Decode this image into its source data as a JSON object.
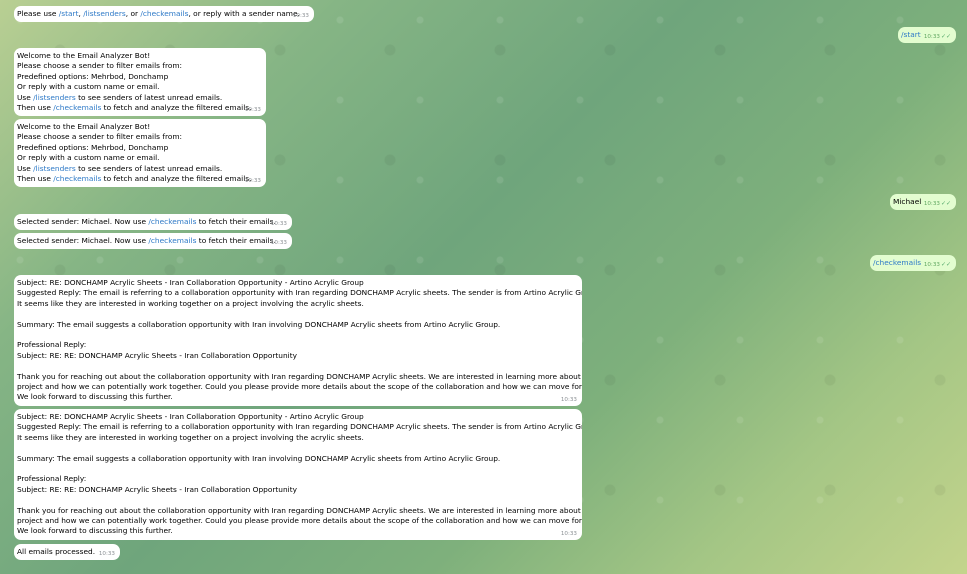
{
  "messages": {
    "m1": {
      "pre": "Please use ",
      "c1": "/start",
      "sep1": ", ",
      "c2": "/listsenders",
      "sep2": ", or ",
      "c3": "/checkemails",
      "post": ", or reply with a sender name.",
      "time": "10:33"
    },
    "start_cmd": {
      "text": "/start",
      "time": "10:33"
    },
    "welcome1": {
      "l1": "Welcome to the Email Analyzer Bot!",
      "l2": "Please choose a sender to filter emails from:",
      "l3": "Predefined options: Mehrbod, Donchamp",
      "l4": "Or reply with a custom name or email.",
      "l5_pre": "Use ",
      "l5_cmd": "/listsenders",
      "l5_post": " to see senders of latest unread emails.",
      "l6_pre": "Then use ",
      "l6_cmd": "/checkemails",
      "l6_post": " to fetch and analyze the filtered emails.",
      "time": "10:33"
    },
    "welcome2": {
      "l1": "Welcome to the Email Analyzer Bot!",
      "l2": "Please choose a sender to filter emails from:",
      "l3": "Predefined options: Mehrbod, Donchamp",
      "l4": "Or reply with a custom name or email.",
      "l5_pre": "Use ",
      "l5_cmd": "/listsenders",
      "l5_post": " to see senders of latest unread emails.",
      "l6_pre": "Then use ",
      "l6_cmd": "/checkemails",
      "l6_post": " to fetch and analyze the filtered emails.",
      "time": "10:33"
    },
    "michael": {
      "text": "Michael",
      "time": "10:33"
    },
    "selected1": {
      "pre": "Selected sender: Michael. Now use ",
      "cmd": "/checkemails",
      "post": " to fetch their emails.",
      "time": "10:33"
    },
    "selected2": {
      "pre": "Selected sender: Michael. Now use ",
      "cmd": "/checkemails",
      "post": " to fetch their emails.",
      "time": "10:33"
    },
    "checkemails_cmd": {
      "text": "/checkemails",
      "time": "10:33"
    },
    "analysis1": {
      "l1": "Subject: RE: DONCHAMP Acrylic Sheets - Iran Collaboration Opportunity - Artino Acrylic Group",
      "l2": "Suggested Reply: The email is referring to a collaboration opportunity with Iran regarding DONCHAMP Acrylic sheets. The sender is from Artino Acrylic Group.",
      "l3": "It seems like they are interested in working together on a project involving the acrylic sheets.",
      "l4": "Summary: The email suggests a collaboration opportunity with Iran involving DONCHAMP Acrylic sheets from Artino Acrylic Group.",
      "l5": "Professional Reply:",
      "l6": "Subject: RE: RE: DONCHAMP Acrylic Sheets - Iran Collaboration Opportunity",
      "l7": "Thank you for reaching out about the collaboration opportunity with Iran regarding DONCHAMP Acrylic sheets. We are interested in learning more about the",
      "l8": "project and how we can potentially work together. Could you please provide more details about the scope of the collaboration and how we can move forward?",
      "l9": "We look forward to discussing this further.",
      "time": "10:33"
    },
    "analysis2": {
      "l1": "Subject: RE: DONCHAMP Acrylic Sheets - Iran Collaboration Opportunity - Artino Acrylic Group",
      "l2": "Suggested Reply: The email is referring to a collaboration opportunity with Iran regarding DONCHAMP Acrylic sheets. The sender is from Artino Acrylic Group.",
      "l3": "It seems like they are interested in working together on a project involving the acrylic sheets.",
      "l4": "Summary: The email suggests a collaboration opportunity with Iran involving DONCHAMP Acrylic sheets from Artino Acrylic Group.",
      "l5": "Professional Reply:",
      "l6": "Subject: RE: RE: DONCHAMP Acrylic Sheets - Iran Collaboration Opportunity",
      "l7": "Thank you for reaching out about the collaboration opportunity with Iran regarding DONCHAMP Acrylic sheets. We are interested in learning more about the",
      "l8": "project and how we can potentially work together. Could you please provide more details about the scope of the collaboration and how we can move forward?",
      "l9": "We look forward to discussing this further.",
      "time": "10:33"
    },
    "processed": {
      "text": "All emails processed.",
      "time": "10:33"
    }
  },
  "icons": {
    "read_check": "double-check-icon"
  },
  "colors": {
    "incoming_bubble": "#ffffff",
    "outgoing_bubble": "#e3fdd0",
    "command_link": "#2d79c7",
    "read_check": "#55a96b"
  }
}
